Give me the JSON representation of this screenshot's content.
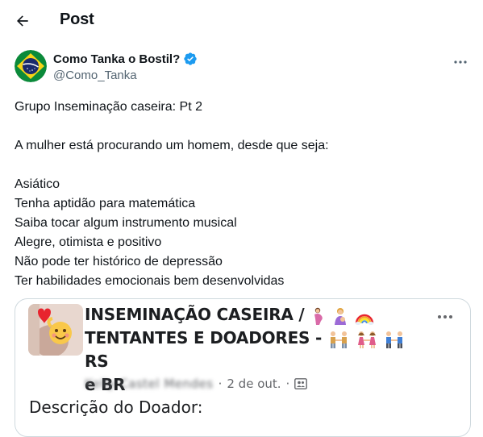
{
  "header": {
    "title": "Post",
    "back_icon": "arrow-left-icon"
  },
  "author": {
    "name": "Como Tanka o Bostil?",
    "handle": "@Como_Tanka",
    "verified_icon": "verified-badge-icon",
    "avatar_icon": "brazil-flag-avatar"
  },
  "post": {
    "lines": [
      "Grupo Inseminação caseira: Pt 2",
      "",
      "A mulher está procurando um homem, desde que seja:",
      "",
      "Asiático",
      "Tenha aptidão para matemática",
      "Saiba tocar algum instrumento musical",
      "Alegre, otimista e positivo",
      "Não pode ter histórico de depressão",
      "Ter habilidades emocionais bem desenvolvidas"
    ]
  },
  "embed": {
    "title_line1": "INSEMINAÇÃO CASEIRA /",
    "title_line2": "TENTANTES E DOADORES -",
    "title_line2_suffix": "RS",
    "title_line3": "e BR",
    "author_blurred": "Kelly Castel Mendes",
    "date": "2 de out.",
    "privacy_icon": "group-audience-icon",
    "description": "Descrição do Doador:"
  },
  "colors": {
    "text": "#0f1419",
    "muted": "#536471",
    "verified": "#1d9bf0",
    "border": "#cfd9de"
  }
}
